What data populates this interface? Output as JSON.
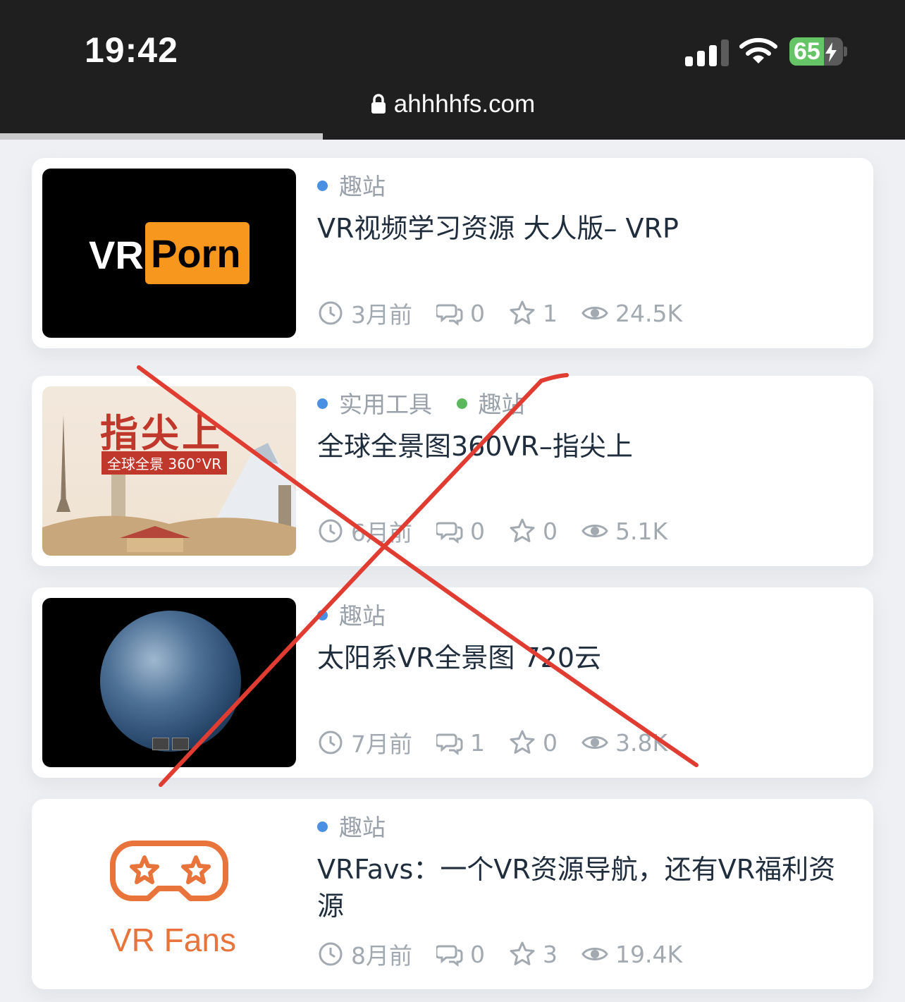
{
  "status_bar": {
    "time": "19:42",
    "battery": "65",
    "battery_level": 0.65
  },
  "browser": {
    "url": "ahhhhfs.com",
    "load_progress": 0.357
  },
  "colors": {
    "tag_blue": "#4a90e2",
    "tag_green": "#5cb85c",
    "strike_red": "#e03c31"
  },
  "posts": [
    {
      "thumb_text": [
        "VR",
        "Porn"
      ],
      "tags": [
        {
          "label": "趣站",
          "color": "#4a90e2"
        }
      ],
      "title": "VR视频学习资源 大人版– VRP",
      "meta": {
        "time": "3月前",
        "comments": "0",
        "stars": "1",
        "views": "24.5K"
      }
    },
    {
      "thumb_text": [
        "指尖上",
        "全球全景 360°VR"
      ],
      "tags": [
        {
          "label": "实用工具",
          "color": "#4a90e2"
        },
        {
          "label": "趣站",
          "color": "#5cb85c"
        }
      ],
      "title": "全球全景图360VR–指尖上",
      "meta": {
        "time": "6月前",
        "comments": "0",
        "stars": "0",
        "views": "5.1K"
      }
    },
    {
      "tags": [
        {
          "label": "趣站",
          "color": "#4a90e2"
        }
      ],
      "title": "太阳系VR全景图 720云",
      "meta": {
        "time": "7月前",
        "comments": "1",
        "stars": "0",
        "views": "3.8K"
      }
    },
    {
      "thumb_text": [
        "VR Fans"
      ],
      "tags": [
        {
          "label": "趣站",
          "color": "#4a90e2"
        }
      ],
      "title": "VRFavs：一个VR资源导航，还有VR福利资源",
      "meta": {
        "time": "8月前",
        "comments": "0",
        "stars": "3",
        "views": "19.4K"
      }
    }
  ],
  "icons": {
    "time": "clock-icon",
    "comments": "comment-icon",
    "stars": "star-icon",
    "views": "eye-icon",
    "url": "lock-icon"
  }
}
